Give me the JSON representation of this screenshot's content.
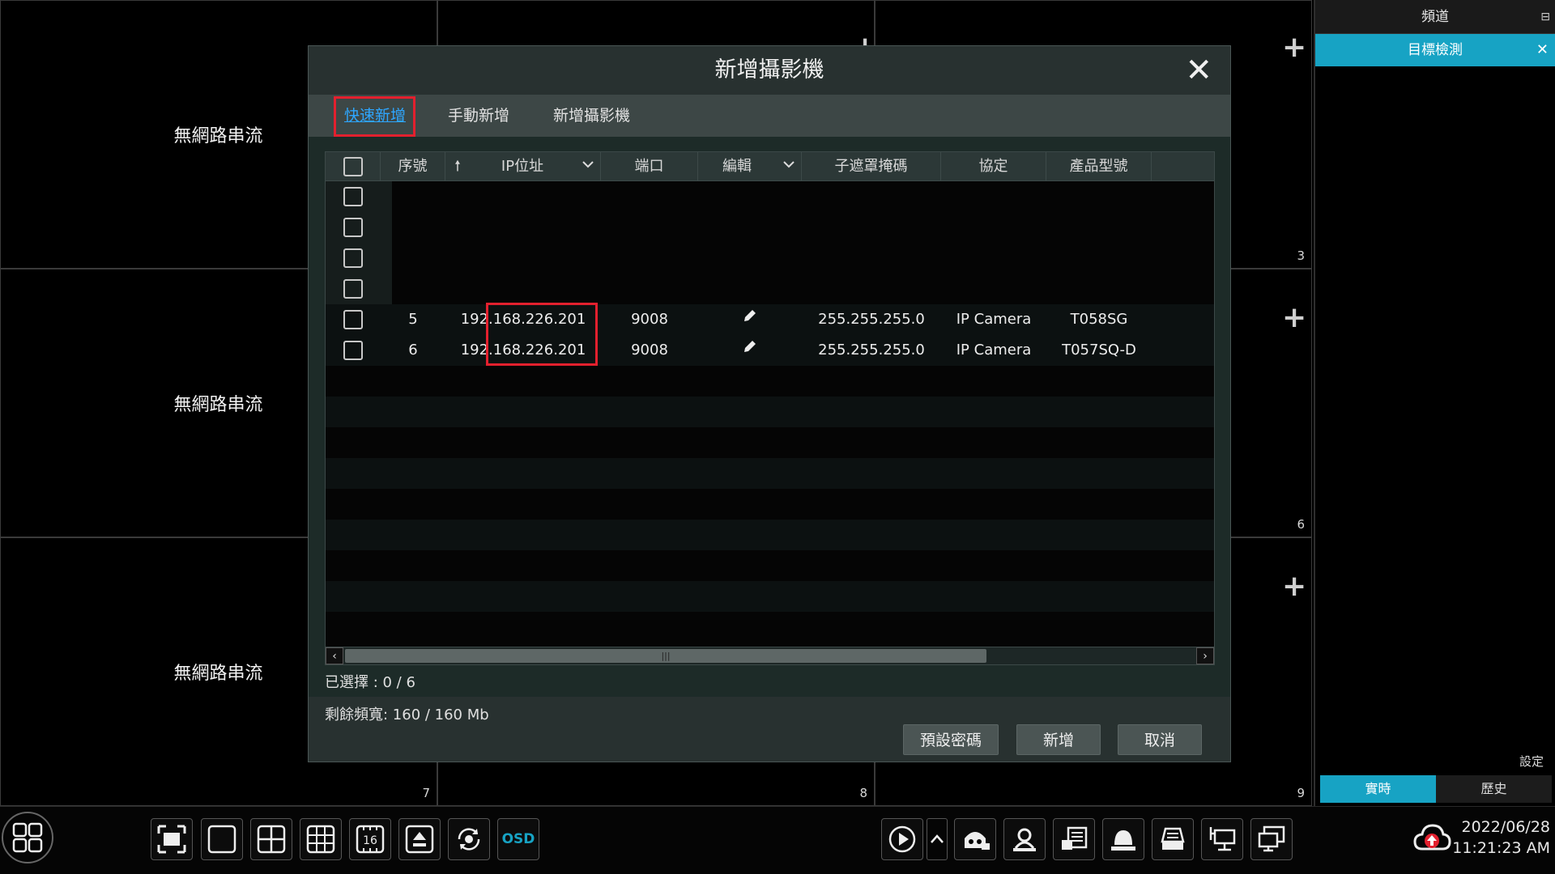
{
  "grid": {
    "no_stream_text": "無網路串流",
    "cells": [
      {
        "num": "",
        "label": "無網路串流"
      },
      {
        "num": "",
        "label": ""
      },
      {
        "num": "3",
        "label": ""
      },
      {
        "num": "",
        "label": "無網路串流"
      },
      {
        "num": "",
        "label": ""
      },
      {
        "num": "6",
        "label": ""
      },
      {
        "num": "7",
        "label": "無網路串流"
      },
      {
        "num": "8",
        "label": ""
      },
      {
        "num": "9",
        "label": ""
      }
    ]
  },
  "right_panel": {
    "header": "頻道",
    "active_item": "目標檢測",
    "settings": "設定",
    "tabs": [
      "實時",
      "歷史"
    ],
    "active_tab_index": 0
  },
  "toolbar": {
    "osd_label": "OSD",
    "layout16_label": "16",
    "date": "2022/06/28",
    "time": "11:21:23 AM"
  },
  "dialog": {
    "title": "新增攝影機",
    "tabs": [
      "快速新增",
      "手動新增",
      "新增攝影機"
    ],
    "active_tab_index": 0,
    "table": {
      "headers": [
        "序號",
        "IP位址",
        "端口",
        "編輯",
        "子遮罩掩碼",
        "協定",
        "產品型號"
      ],
      "empty_row_count": 4,
      "rows": [
        {
          "seq": "5",
          "ip": "192.168.226.201",
          "port": "9008",
          "mask": "255.255.255.0",
          "protocol": "IP Camera",
          "model": "T058SG"
        },
        {
          "seq": "6",
          "ip": "192.168.226.201",
          "port": "9008",
          "mask": "255.255.255.0",
          "protocol": "IP Camera",
          "model": "T057SQ-D"
        }
      ]
    },
    "selected_text": "已選擇 : 0 / 6",
    "bandwidth_text": "剩餘頻寬: 160 / 160 Mb",
    "buttons": {
      "default_password": "預設密碼",
      "add": "新增",
      "cancel": "取消"
    }
  },
  "colors": {
    "accent": "#17a3c4",
    "highlight_box": "#e3202e",
    "active_tab_text": "#2ea6ff"
  }
}
